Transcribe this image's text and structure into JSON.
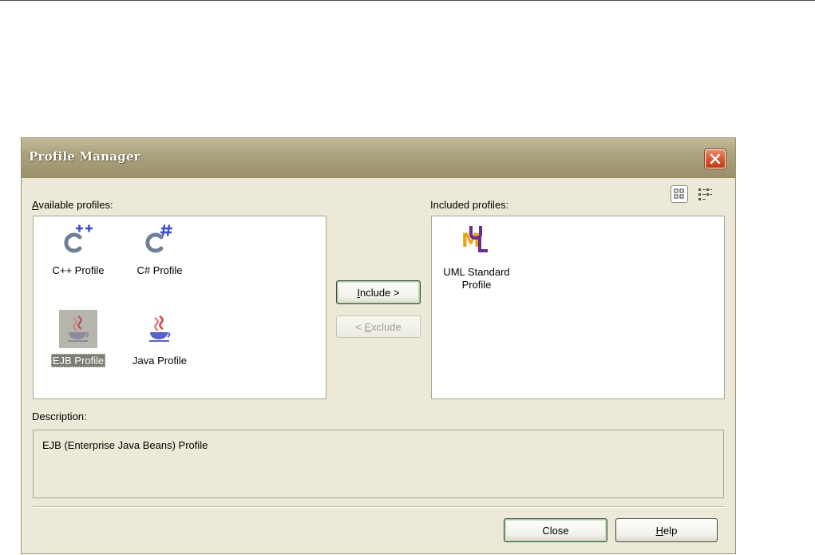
{
  "window": {
    "title": "Profile Manager"
  },
  "labels": {
    "available_prefix": "A",
    "available_rest": "vailable profiles:",
    "included": "Included profiles:",
    "description": "Description:"
  },
  "available_profiles": [
    {
      "name": "C++ Profile",
      "icon": "cpp-icon"
    },
    {
      "name": "C# Profile",
      "icon": "csharp-icon"
    },
    {
      "name": "EJB Profile",
      "icon": "ejb-icon",
      "selected": true
    },
    {
      "name": "Java Profile",
      "icon": "java-icon"
    }
  ],
  "included_profiles": [
    {
      "name_line1": "UML Standard",
      "name_line2": "Profile",
      "icon": "uml-icon"
    }
  ],
  "buttons": {
    "include_prefix": "",
    "include_u": "I",
    "include_rest": "nclude >",
    "exclude_prefix": "< ",
    "exclude_u": "E",
    "exclude_rest": "xclude",
    "close": "Close",
    "help_u": "H",
    "help_rest": "elp"
  },
  "description_text": "EJB (Enterprise Java Beans) Profile",
  "colors": {
    "accent_green": "#3b4b3b",
    "selection": "#7c7c73",
    "titlebar": "#a39a74"
  }
}
